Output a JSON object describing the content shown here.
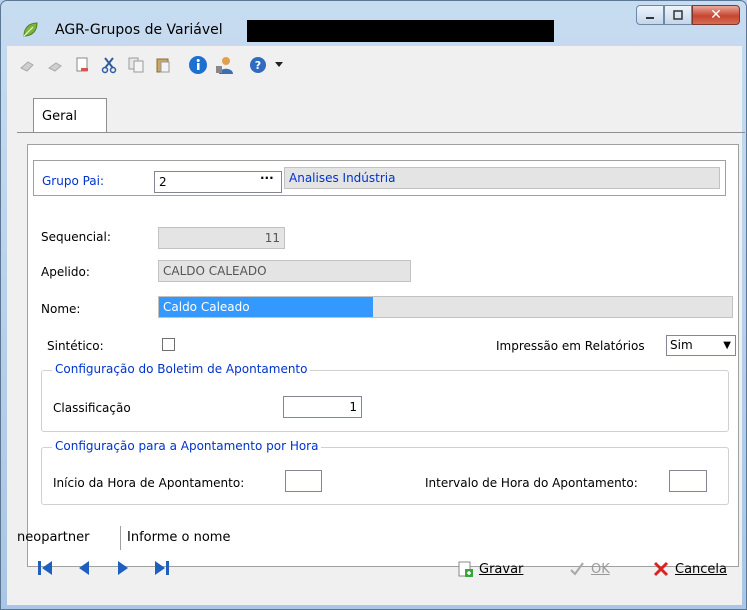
{
  "window": {
    "title": "AGR-Grupos de Variável"
  },
  "toolbar": {
    "icons": [
      "edit-icon",
      "undo-icon",
      "new-icon",
      "cut-icon",
      "copy-icon",
      "paste-icon",
      "info-icon",
      "user-icon",
      "help-icon",
      "dropdown-arrow-icon"
    ]
  },
  "tabs": [
    {
      "label": "Geral"
    }
  ],
  "form": {
    "grupo_pai": {
      "label": "Grupo Pai:",
      "value": "2",
      "ellipsis": "···",
      "description": "Analises Indústria"
    },
    "sequencial": {
      "label": "Sequencial:",
      "value": "11"
    },
    "apelido": {
      "label": "Apelido:",
      "value": "CALDO CALEADO"
    },
    "nome": {
      "label": "Nome:",
      "value": "Caldo Caleado"
    },
    "sintetico": {
      "label": "Sintético:",
      "checked": false
    },
    "impressao": {
      "label": "Impressão em Relatórios",
      "value": "Sim"
    },
    "boletim": {
      "legend": "Configuração do Boletim de Apontamento",
      "classificacao_label": "Classificação",
      "classificacao_value": "1"
    },
    "hora": {
      "legend": "Configuração para a Apontamento por Hora",
      "inicio_label": "Início da Hora de Apontamento:",
      "inicio_value": "",
      "intervalo_label": "Intervalo de Hora do Apontamento:",
      "intervalo_value": ""
    }
  },
  "status": {
    "user": "neopartner",
    "message": "Informe o nome"
  },
  "actions": {
    "gravar": "Gravar",
    "ok": "OK",
    "cancela": "Cancela"
  },
  "colors": {
    "accent_blue": "#0033cc",
    "selection": "#3399ff",
    "close_red": "#c7452f"
  }
}
